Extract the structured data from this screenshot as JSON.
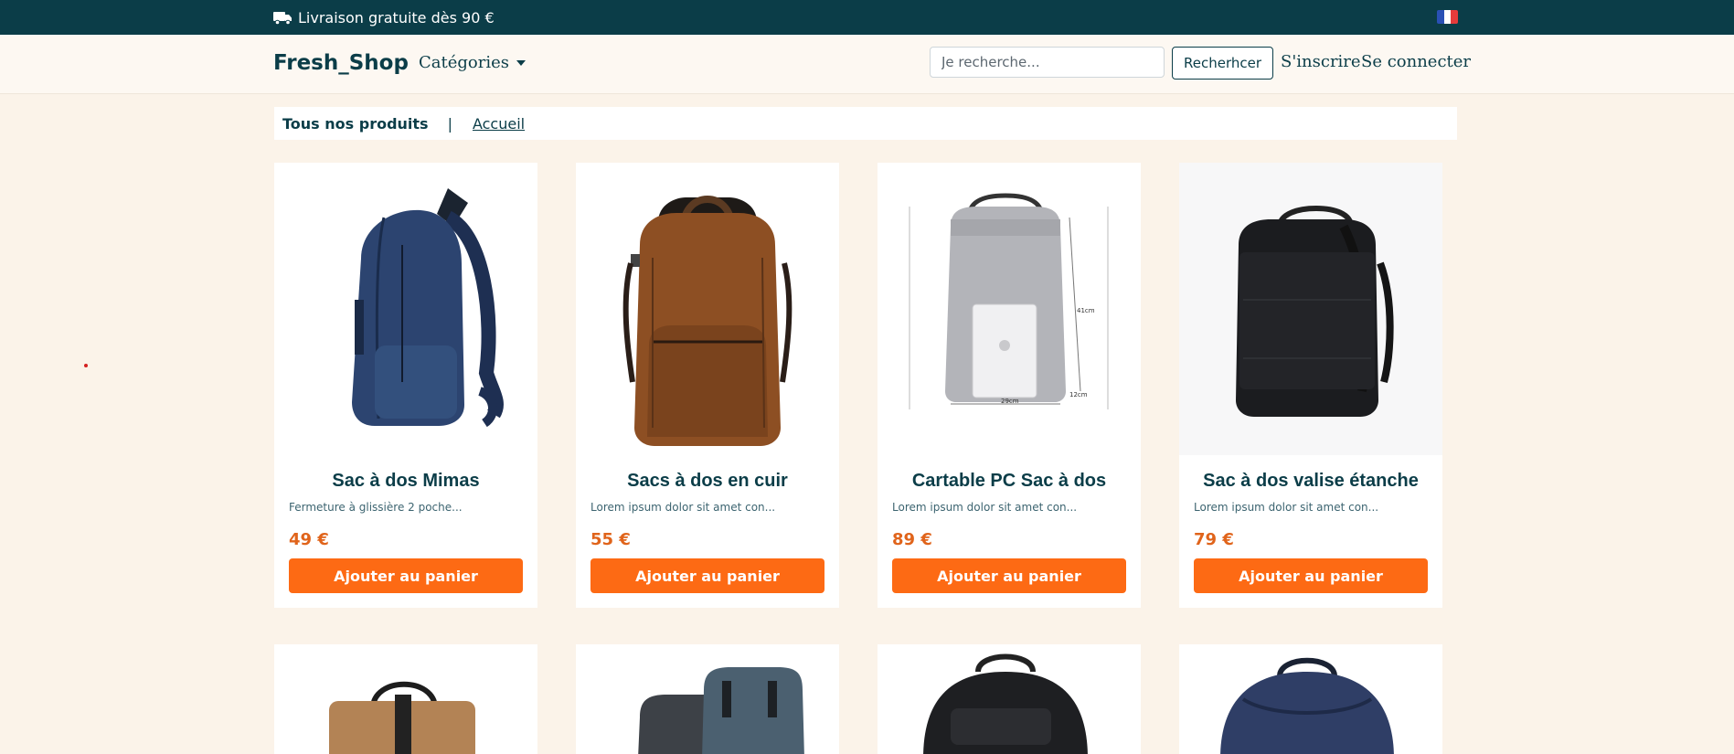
{
  "topbar": {
    "shipping_text": "Livraison gratuite dès 90 €",
    "truck_icon": "truck-icon",
    "language_flag": "fr"
  },
  "navbar": {
    "brand": "Fresh_Shop",
    "categories_label": "Catégories",
    "search_placeholder": "Je recherche...",
    "search_button": "Recherhcer",
    "signup": "S'inscrire",
    "login": "Se connecter"
  },
  "breadcrumb": {
    "current": "Tous nos produits",
    "separator": "|",
    "home": "Accueil"
  },
  "products": [
    {
      "name": "Sac à dos Mimas",
      "desc": "Fermeture à glissière 2 poche...",
      "price": "49 €",
      "button": "Ajouter au panier"
    },
    {
      "name": "Sacs à dos en cuir",
      "desc": "Lorem ipsum dolor sit amet con...",
      "price": "55 €",
      "button": "Ajouter au panier"
    },
    {
      "name": "Cartable PC Sac à dos",
      "desc": "Lorem ipsum dolor sit amet con...",
      "price": "89 €",
      "button": "Ajouter au panier",
      "image_labels": {
        "height": "41cm",
        "depth": "12cm",
        "width": "29cm"
      }
    },
    {
      "name": "Sac à dos valise étanche",
      "desc": "Lorem ipsum dolor sit amet con...",
      "price": "79 €",
      "button": "Ajouter au panier"
    }
  ],
  "colors": {
    "topbar_bg": "#0b3d48",
    "page_bg": "#fbf3e9",
    "accent_orange": "#fd6a14",
    "price_orange": "#e0641b"
  }
}
